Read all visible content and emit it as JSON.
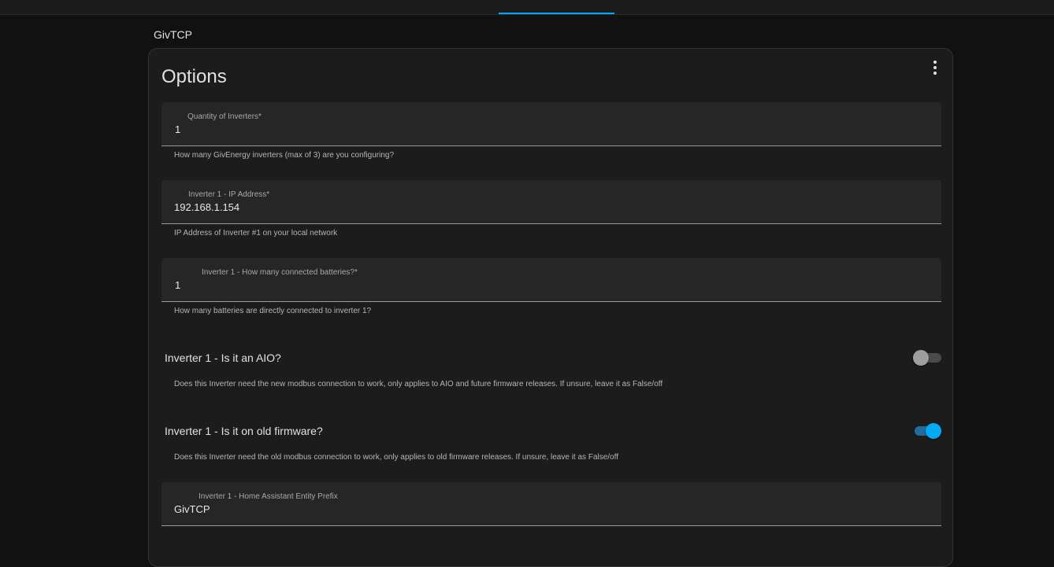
{
  "header": {
    "section_title": "GivTCP"
  },
  "colors": {
    "accent": "#03a9f4",
    "background": "#111111",
    "card": "#1c1c1c",
    "field": "#262626"
  },
  "card": {
    "title": "Options",
    "menu_icon": "kebab-menu-icon"
  },
  "fields": {
    "quantity": {
      "label": "Quantity of Inverters*",
      "value": "1",
      "helper": "How many GivEnergy inverters (max of 3) are you configuring?"
    },
    "ip": {
      "label": "Inverter 1 - IP Address*",
      "value": "192.168.1.154",
      "helper": "IP Address of Inverter #1 on your local network"
    },
    "batteries": {
      "label": "Inverter 1 - How many connected batteries?*",
      "value": "1",
      "helper": "How many batteries are directly connected to inverter 1?"
    },
    "prefix": {
      "label": "Inverter 1 - Home Assistant Entity Prefix",
      "value": "GivTCP"
    }
  },
  "switches": {
    "aio": {
      "label": "Inverter 1 - Is it an AIO?",
      "state": "off",
      "helper": "Does this Inverter need the new modbus connection to work, only applies to AIO and future firmware releases. If unsure, leave it as False/off"
    },
    "old_firmware": {
      "label": "Inverter 1 - Is it on old firmware?",
      "state": "on",
      "helper": "Does this Inverter need the old modbus connection to work, only applies to old firmware releases. If unsure, leave it as False/off"
    }
  }
}
